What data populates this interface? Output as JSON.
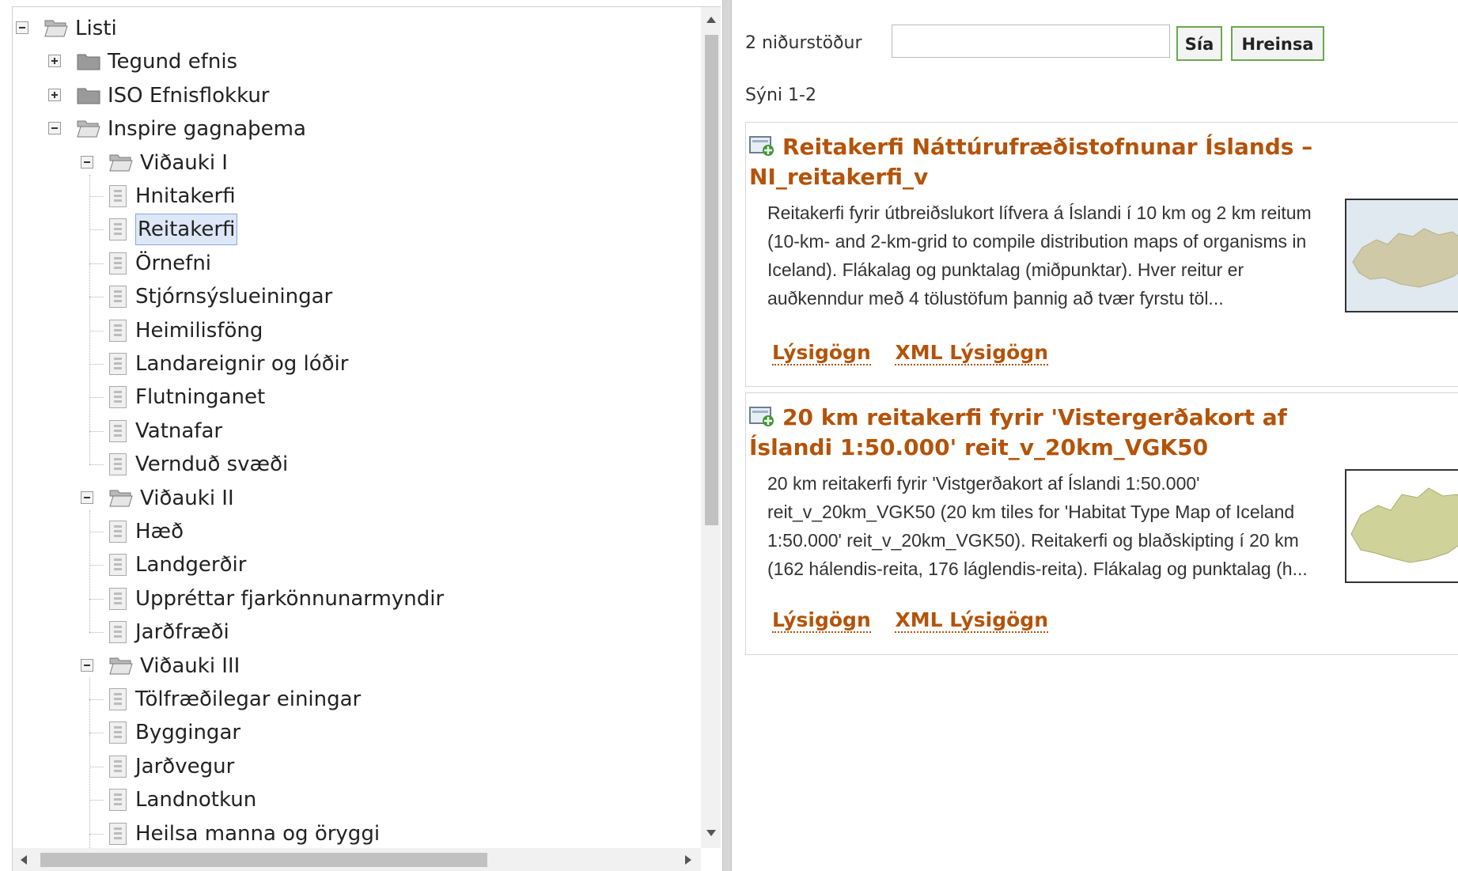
{
  "tree": {
    "items": [
      {
        "label": "Listi",
        "level": 0,
        "kind": "folder",
        "toggle": "minus"
      },
      {
        "label": "Tegund efnis",
        "level": 1,
        "kind": "folder",
        "toggle": "plus"
      },
      {
        "label": "ISO Efnisflokkur",
        "level": 1,
        "kind": "folder",
        "toggle": "plus"
      },
      {
        "label": "Inspire gagnaþema",
        "level": 1,
        "kind": "folder",
        "toggle": "minus"
      },
      {
        "label": "Viðauki I",
        "level": 2,
        "kind": "folder",
        "toggle": "minus"
      },
      {
        "label": "Hnitakerfi",
        "level": 3,
        "kind": "leaf"
      },
      {
        "label": "Reitakerfi",
        "level": 3,
        "kind": "leaf",
        "selected": true
      },
      {
        "label": "Örnefni",
        "level": 3,
        "kind": "leaf"
      },
      {
        "label": "Stjórnsýslueiningar",
        "level": 3,
        "kind": "leaf"
      },
      {
        "label": "Heimilisföng",
        "level": 3,
        "kind": "leaf"
      },
      {
        "label": "Landareignir og lóðir",
        "level": 3,
        "kind": "leaf"
      },
      {
        "label": "Flutninganet",
        "level": 3,
        "kind": "leaf"
      },
      {
        "label": "Vatnafar",
        "level": 3,
        "kind": "leaf"
      },
      {
        "label": "Vernduð svæði",
        "level": 3,
        "kind": "leaf",
        "last": true
      },
      {
        "label": "Viðauki II",
        "level": 2,
        "kind": "folder",
        "toggle": "minus"
      },
      {
        "label": "Hæð",
        "level": 3,
        "kind": "leaf"
      },
      {
        "label": "Landgerðir",
        "level": 3,
        "kind": "leaf"
      },
      {
        "label": "Uppréttar fjarkönnunarmyndir",
        "level": 3,
        "kind": "leaf"
      },
      {
        "label": "Jarðfræði",
        "level": 3,
        "kind": "leaf",
        "last": true
      },
      {
        "label": "Viðauki III",
        "level": 2,
        "kind": "folder",
        "toggle": "minus"
      },
      {
        "label": "Tölfræðilegar einingar",
        "level": 3,
        "kind": "leaf"
      },
      {
        "label": "Byggingar",
        "level": 3,
        "kind": "leaf"
      },
      {
        "label": "Jarðvegur",
        "level": 3,
        "kind": "leaf"
      },
      {
        "label": "Landnotkun",
        "level": 3,
        "kind": "leaf"
      },
      {
        "label": "Heilsa manna og öryggi",
        "level": 3,
        "kind": "leaf"
      }
    ]
  },
  "filter": {
    "count_label": "2 niðurstöður",
    "input_value": "",
    "input_placeholder": "",
    "filter_button": "Sía",
    "clear_button": "Hreinsa",
    "showing_label": "Sýni 1-2"
  },
  "results": [
    {
      "title": "Reitakerfi Náttúrufræðistofnunar Íslands – NI_reitakerfi_v",
      "description": "Reitakerfi fyrir útbreiðslukort lífvera á Íslandi í 10 km og 2 km reitum (10-km- and 2-km-grid to compile distribution maps of organisms in Iceland). Flákalag og punktalag (miðpunktar). Hver reitur er auðkenndur með 4 tölustöfum þannig að tvær fyrstu töl...",
      "link_metadata": "Lýsigögn",
      "link_xml": "XML Lýsigögn"
    },
    {
      "title": "20 km reitakerfi fyrir 'Vistergerðakort af Íslandi 1:50.000' reit_v_20km_VGK50",
      "description": "20 km reitakerfi fyrir 'Vistgerðakort af Íslandi 1:50.000' reit_v_20km_VGK50 (20 km tiles for 'Habitat Type Map of Iceland 1:50.000' reit_v_20km_VGK50). Reitakerfi og blaðskipting í 20 km (162 hálendis-reita, 176 láglendis-reita). Flákalag og punktalag (h...",
      "link_metadata": "Lýsigögn",
      "link_xml": "XML Lýsigögn"
    }
  ],
  "colors": {
    "link": "#b45309",
    "button_border": "#6aa84f",
    "selection": "#dde7f7"
  }
}
